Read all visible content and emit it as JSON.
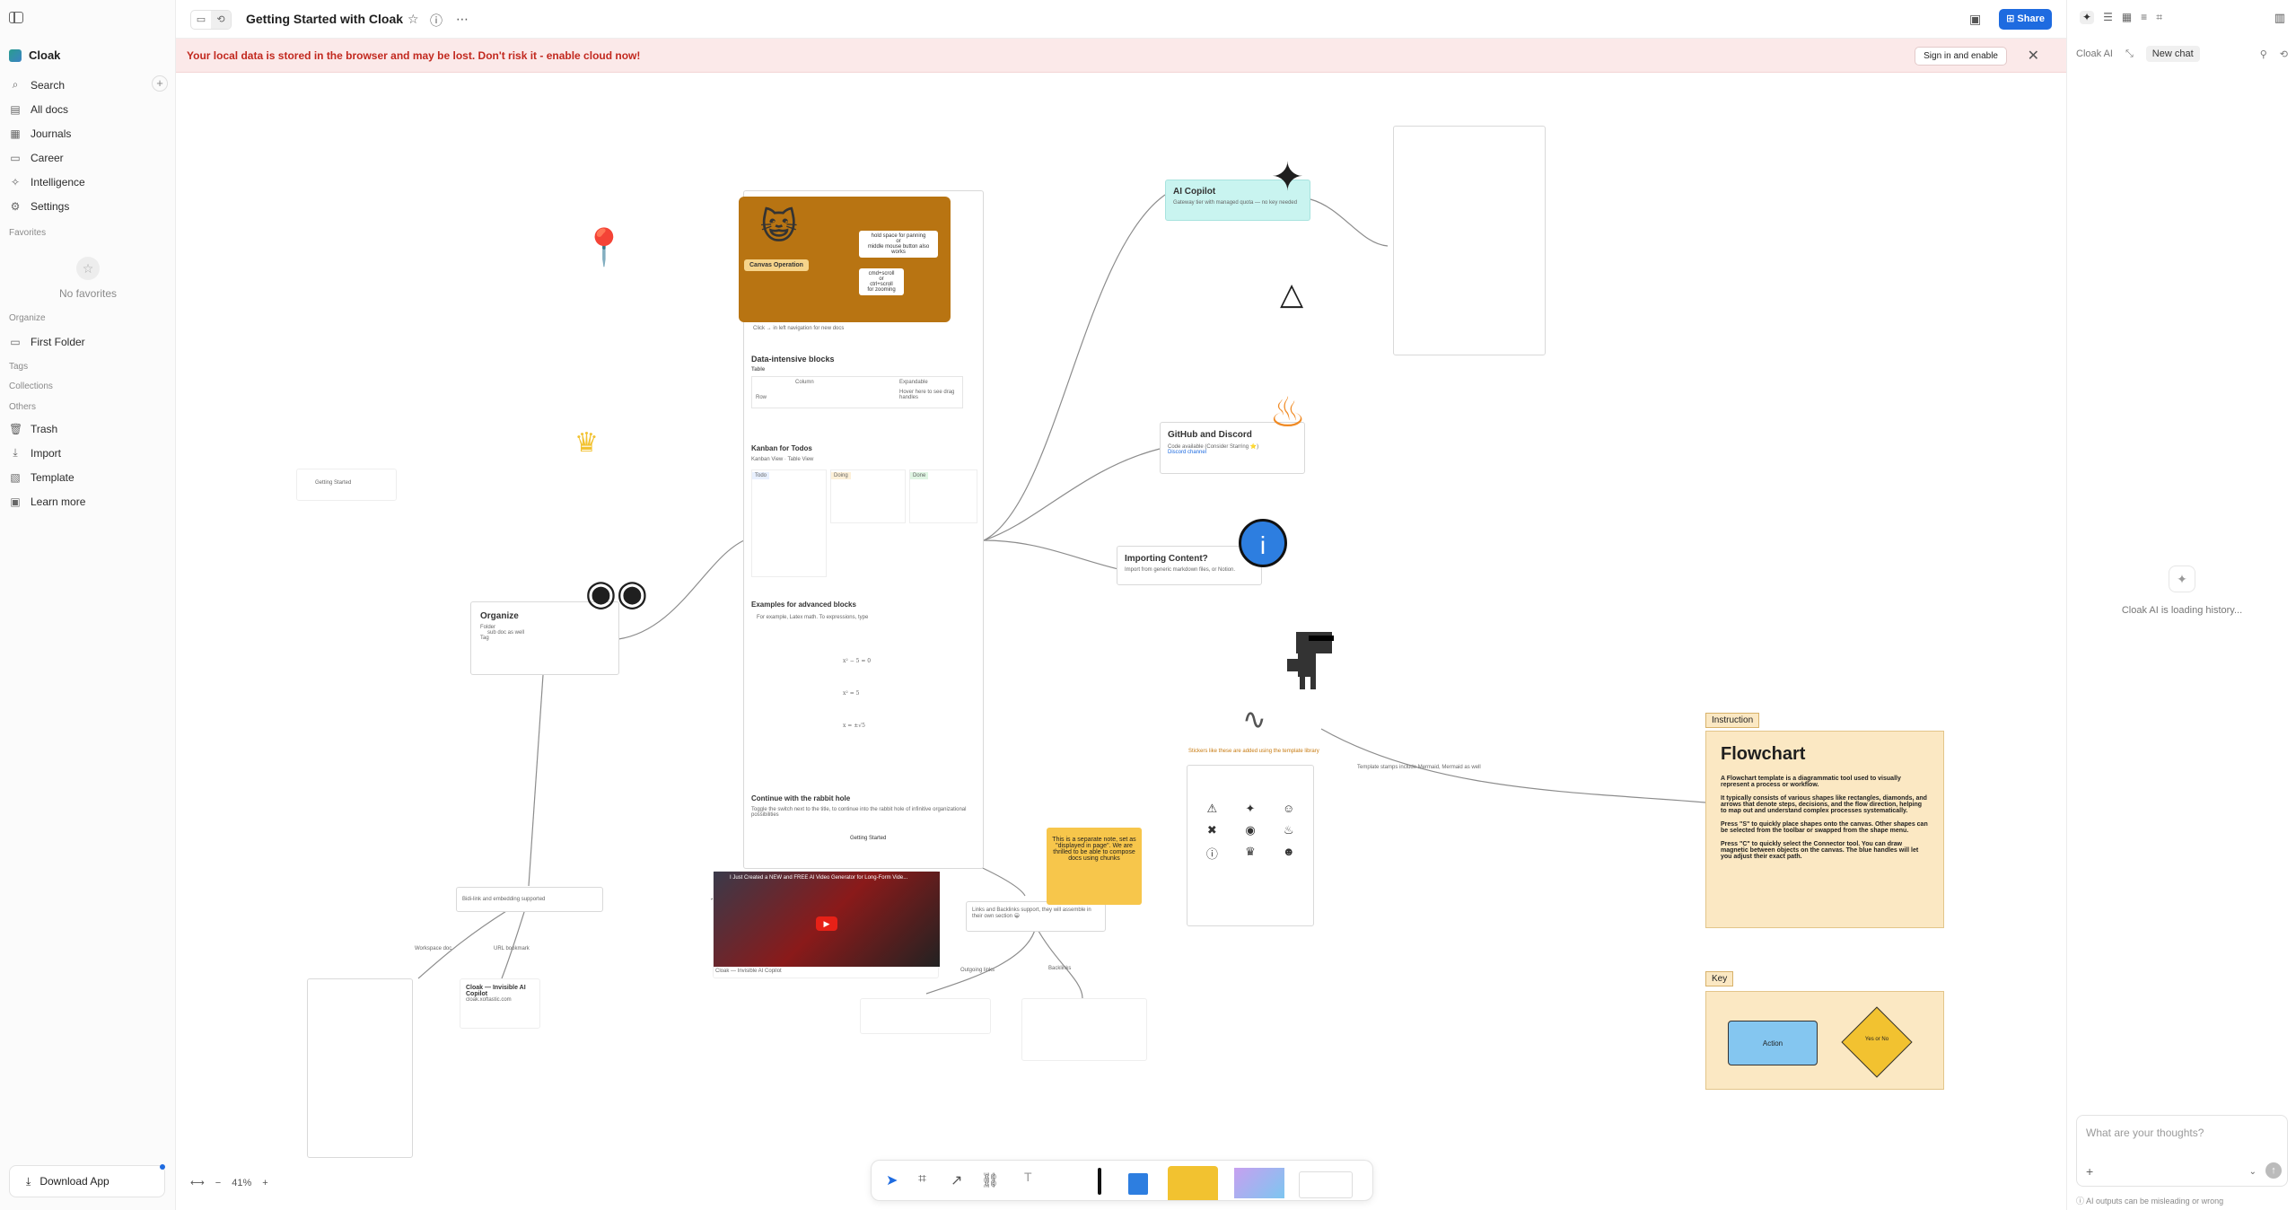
{
  "workspace": {
    "name": "Cloak"
  },
  "sidebar": {
    "items": [
      {
        "label": "Search",
        "icon": "search-icon"
      },
      {
        "label": "All docs",
        "icon": "docs-icon"
      },
      {
        "label": "Journals",
        "icon": "calendar-icon"
      },
      {
        "label": "Career",
        "icon": "folder-icon"
      },
      {
        "label": "Intelligence",
        "icon": "sparkle-icon"
      },
      {
        "label": "Settings",
        "icon": "gear-icon"
      }
    ],
    "favorites_label": "Favorites",
    "no_favorites": "No favorites",
    "organize_label": "Organize",
    "folder": "First Folder",
    "tags_label": "Tags",
    "collections_label": "Collections",
    "others_label": "Others",
    "others": [
      {
        "label": "Trash",
        "icon": "trash-icon"
      },
      {
        "label": "Import",
        "icon": "import-icon"
      },
      {
        "label": "Template",
        "icon": "template-icon"
      },
      {
        "label": "Learn more",
        "icon": "info-icon"
      }
    ],
    "download": "Download App"
  },
  "topbar": {
    "title": "Getting Started with Cloak",
    "share": "Share"
  },
  "banner": {
    "text": "Your local data is stored in the browser and may be lost. Don't risk it - enable cloud now!",
    "button": "Sign in and enable"
  },
  "canvas": {
    "cat_card": {
      "root": "Canvas Operation",
      "node1": "hold space for panning\nor\nmiddle mouse button also works",
      "node2": "cmd+scroll\nor\nctrl+scroll\nfor zooming"
    },
    "doc": {
      "data_heading": "Data-intensive blocks",
      "table_label": "Table",
      "col1": "Column",
      "col2": "Expandable",
      "row_label": "Row",
      "hover_text": "Hover here to see drag handles",
      "kanban_heading": "Kanban for Todos",
      "kanban_view": "Kanban View",
      "table_view": "Table View",
      "cols": [
        "Todo",
        "Doing",
        "Done"
      ],
      "advanced_heading": "Examples for advanced blocks",
      "math_intro": "For example, Latex math. To expressions, type",
      "rabbit_heading": "Continue with the rabbit hole",
      "rabbit_text": "Toggle the switch next to the title, to continue into the rabbit hole of infinitive organizational possibilities",
      "link_label": "Getting Started",
      "clickable_text": "Click → in left navigation for new docs"
    },
    "ai_copilot": {
      "title": "AI Copilot",
      "item": "Gateway tier with managed quota — no key needed"
    },
    "github": {
      "title": "GitHub and Discord",
      "items": [
        "Code available (Consider Starring ⭐)",
        "Discord channel"
      ]
    },
    "importing": {
      "title": "Importing Content?",
      "text": "Import from generic markdown files, or Notion."
    },
    "organize_card": {
      "title": "Organize",
      "items": [
        "Folder",
        "sub doc as well",
        "Tag"
      ]
    },
    "bidir": "Bidi-link and embedding supported",
    "workspace_doc": "Workspace doc",
    "url_bookmark": "URL bookmark",
    "cloak_bookmark": {
      "title": "Cloak — Invisible AI Copilot",
      "url": "cloak.xoftastic.com"
    },
    "video_title": "I Just Created a NEW and FREE AI Video Generator for Long-Form Vide...",
    "video_caption": "Cloak — Invisible AI Copilot",
    "linked_text": "Links and Backlinks support, they will assemble in their own section 😀",
    "outgoing": "Outgoing links",
    "backlinks": "Backlinks",
    "sticky_note": "This is a separate note, set as \"displayed in page\". We are thrilled to be able to compose docs using chunks",
    "stickers_caption": "Stickers like these are added using the template library",
    "template_caption": "Template stamps include Mermaid, Mermaid as well",
    "instruction_label": "Instruction",
    "flowchart": {
      "title": "Flowchart",
      "p1": "A Flowchart template is a diagrammatic tool used to visually represent a process or workflow.",
      "p2": "It typically consists of various shapes like rectangles, diamonds, and arrows that denote steps, decisions, and the flow direction, helping to map out and understand complex processes systematically.",
      "p3": "Press \"S\" to quickly place shapes onto the canvas. Other shapes can be selected from the toolbar or swapped from the shape menu.",
      "p4": "Press \"C\" to quickly select the Connector tool. You can draw magnetic between objects on the canvas. The blue handles will let you adjust their exact path."
    },
    "key_label": "Key",
    "key_action": "Action",
    "key_decision": "Yes or No",
    "mini_doc_title": "Getting Started"
  },
  "zoom": {
    "value": "41%"
  },
  "ai": {
    "label": "Cloak AI",
    "new_chat": "New chat",
    "loading": "Cloak AI is loading history...",
    "placeholder": "What are your thoughts?",
    "footer": "AI outputs can be misleading or wrong"
  },
  "colors": {
    "accent": "#1e6be0",
    "banner_bg": "#fbe9e9",
    "banner_text": "#c2291f",
    "cat_card": "#b87412",
    "copilot": "#c9f4f0",
    "flowchart_bg": "#fbe8c3",
    "sticky": "#f7c64b"
  }
}
